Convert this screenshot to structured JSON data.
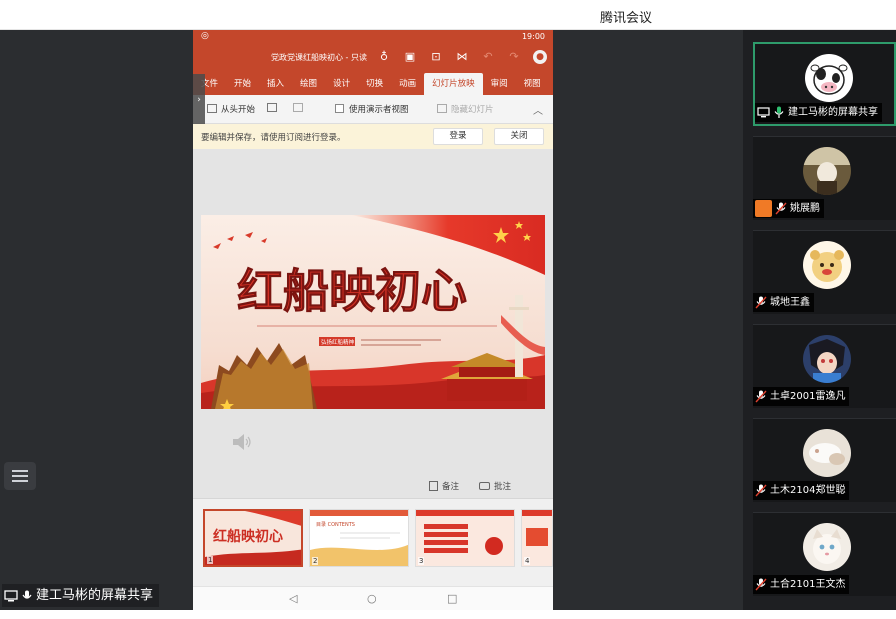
{
  "window": {
    "title": "腾讯会议"
  },
  "share": {
    "label": "建工马彬的屏幕共享",
    "phone": {
      "status_time": "19:00",
      "doc_title": "党政党课红船映初心 - 只读",
      "menu_tabs": [
        "文件",
        "开始",
        "插入",
        "绘图",
        "设计",
        "切换",
        "动画",
        "幻灯片放映",
        "审阅",
        "视图"
      ],
      "active_tab": "幻灯片放映",
      "ribbon": {
        "from_start": "从头开始",
        "presenter_view": "使用演示者视图",
        "hide_slide": "隐藏幻灯片"
      },
      "notice": {
        "message": "要编辑并保存，请使用订阅进行登录。",
        "login": "登录",
        "close": "关闭"
      },
      "slide": {
        "headline": "红船映初心",
        "subtitle_line": "不忘初心 牢记使命",
        "badge": "弘扬红船精神"
      },
      "notes_label": "备注",
      "comments_label": "批注",
      "thumbnails": [
        {
          "num": "1",
          "text": "红船映初心"
        },
        {
          "num": "2",
          "text": "目录 CONTENTS"
        },
        {
          "num": "3",
          "text": ""
        },
        {
          "num": "4",
          "text": ""
        }
      ]
    }
  },
  "participants": [
    {
      "name": "建工马彬的屏幕共享",
      "kind": "sharing"
    },
    {
      "name": "姚展鹏",
      "kind": "person"
    },
    {
      "name": "城地王鑫",
      "kind": "muted"
    },
    {
      "name": "土卓2001雷逸凡",
      "kind": "muted"
    },
    {
      "name": "土木2104郑世聪",
      "kind": "muted"
    },
    {
      "name": "土合2101王文杰",
      "kind": "muted"
    }
  ],
  "colors": {
    "ppt_red": "#c4472b",
    "panel_bg": "#1e1f22",
    "active_border": "#2e9b6b",
    "notice_bg": "#fbf3d9"
  }
}
